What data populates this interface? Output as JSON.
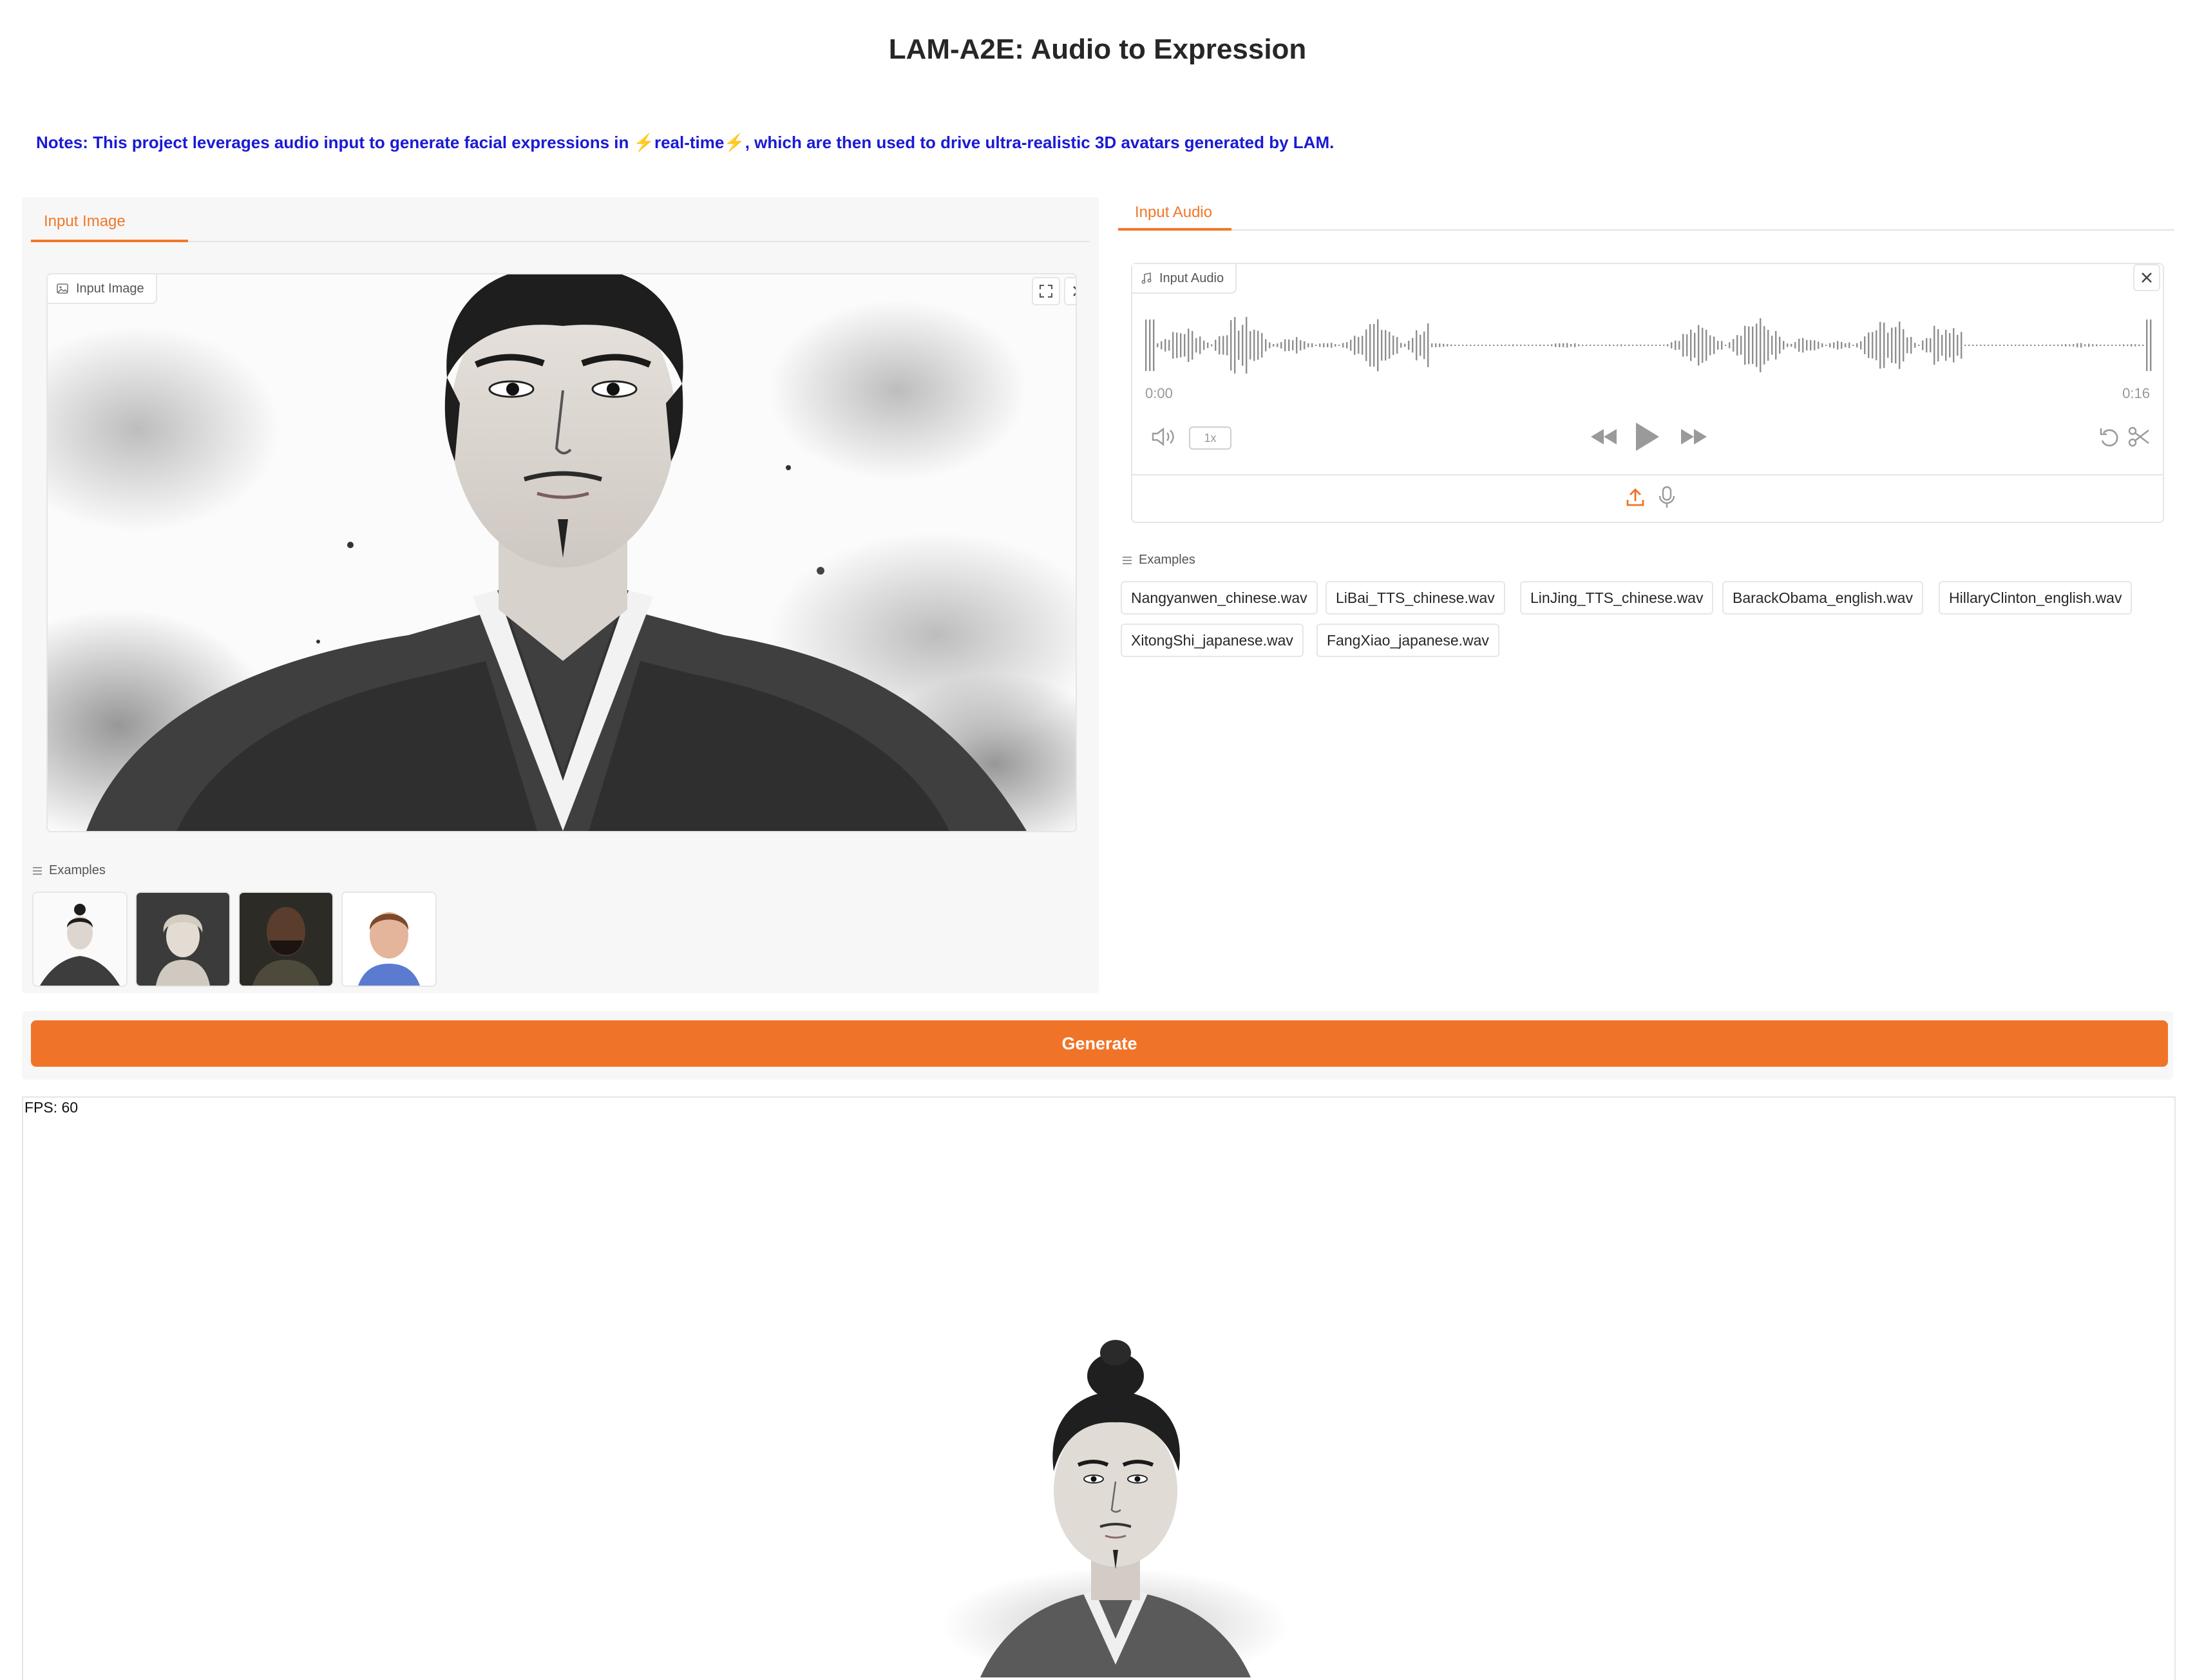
{
  "page": {
    "title": "LAM-A2E: Audio to Expression",
    "notes_prefix": "Notes: This project leverages audio input to generate facial expressions in ",
    "notes_highlight": "real-time",
    "notes_suffix": ", which are then used to drive ultra-realistic 3D avatars generated by LAM.",
    "bolt_symbol": "⚡"
  },
  "image_panel": {
    "tab_label": "Input Image",
    "box_label": "Input Image",
    "fullscreen_icon": "fullscreen-icon",
    "close_icon": "close-icon",
    "examples_label": "Examples",
    "example_thumbs": [
      "ink-portrait-man",
      "marble-statue",
      "bald-bearded-man",
      "older-man-blue-shirt"
    ]
  },
  "audio_panel": {
    "tab_label": "Input Audio",
    "box_label": "Input Audio",
    "time_start": "0:00",
    "time_end": "0:16",
    "playback_rate": "1x",
    "examples_label": "Examples",
    "examples": [
      "Nangyanwen_chinese.wav",
      "LiBai_TTS_chinese.wav",
      "LinJing_TTS_chinese.wav",
      "BarackObama_english.wav",
      "HillaryClinton_english.wav",
      "XitongShi_japanese.wav",
      "FangXiao_japanese.wav"
    ]
  },
  "generate_label": "Generate",
  "render": {
    "fps_text": "FPS: 60"
  },
  "colors": {
    "accent": "#f07428",
    "notes": "#1a1ad6",
    "bolt": "#f5b301"
  }
}
